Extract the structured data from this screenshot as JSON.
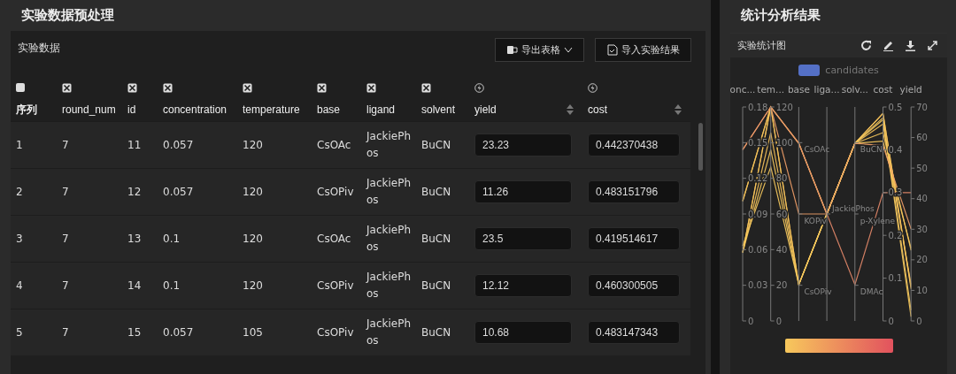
{
  "left_panel": {
    "title": "实验数据预处理",
    "card_title": "实验数据",
    "buttons": [
      {
        "label": "导出表格",
        "kind": "export"
      },
      {
        "label": "导入实验结果",
        "kind": "import"
      }
    ],
    "table": {
      "select_all": {
        "checked": false
      },
      "columns": [
        {
          "label": "序列",
          "kind": "index"
        },
        {
          "label": "round_num",
          "kind": "param"
        },
        {
          "label": "id",
          "kind": "param"
        },
        {
          "label": "concentration",
          "kind": "param"
        },
        {
          "label": "temperature",
          "kind": "param"
        },
        {
          "label": "base",
          "kind": "param"
        },
        {
          "label": "ligand",
          "kind": "param"
        },
        {
          "label": "solvent",
          "kind": "param"
        },
        {
          "label": "yield",
          "kind": "objective"
        },
        {
          "label": "cost",
          "kind": "objective"
        }
      ],
      "rows": [
        {
          "cells": [
            "1",
            "7",
            "11",
            "0.057",
            "120",
            "CsOAc",
            "JackiePhos",
            "BuCN",
            "23.23",
            "0.442370438"
          ]
        },
        {
          "cells": [
            "2",
            "7",
            "12",
            "0.057",
            "120",
            "CsOPiv",
            "JackiePhos",
            "BuCN",
            "11.26",
            "0.483151796"
          ]
        },
        {
          "cells": [
            "3",
            "7",
            "13",
            "0.1",
            "120",
            "CsOAc",
            "JackiePhos",
            "BuCN",
            "23.5",
            "0.419514617"
          ]
        },
        {
          "cells": [
            "4",
            "7",
            "14",
            "0.1",
            "120",
            "CsOPiv",
            "JackiePhos",
            "BuCN",
            "12.12",
            "0.460300505"
          ]
        },
        {
          "cells": [
            "5",
            "7",
            "15",
            "0.057",
            "105",
            "CsOPiv",
            "JackiePhos",
            "BuCN",
            "10.68",
            "0.483147343"
          ]
        }
      ]
    }
  },
  "right_panel": {
    "title": "统计分析结果",
    "chart_title": "实验统计图",
    "legend": "candidates",
    "axes": [
      {
        "name": "onc...",
        "kind": "value",
        "ticks": [
          "0.18",
          "0.15",
          "0.12",
          "0.09",
          "0.06",
          "0.03",
          "0"
        ]
      },
      {
        "name": "tem...",
        "kind": "value",
        "ticks": [
          "120",
          "100",
          "80",
          "60",
          "40",
          "20",
          "0"
        ]
      },
      {
        "name": "base",
        "kind": "category",
        "ticks": [
          "CsOAc",
          "KOPiv",
          "CsOPiv"
        ]
      },
      {
        "name": "liga...",
        "kind": "category",
        "ticks": [
          "JackiePhos"
        ]
      },
      {
        "name": "solv...",
        "kind": "category",
        "ticks": [
          "BuCN",
          "p-Xylene",
          "DMAc"
        ]
      },
      {
        "name": "cost",
        "kind": "value",
        "ticks": [
          "0.5",
          "0.4",
          "0.3",
          "0.2",
          "0.1",
          "0"
        ]
      },
      {
        "name": "yield",
        "kind": "value",
        "ticks": [
          "70",
          "60",
          "50",
          "40",
          "30",
          "20",
          "10",
          "0"
        ]
      }
    ]
  }
}
